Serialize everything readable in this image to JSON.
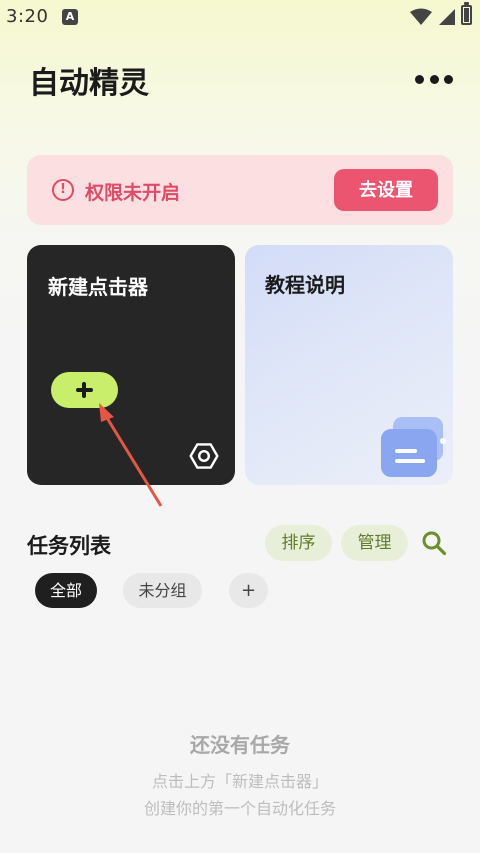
{
  "status_bar": {
    "time": "3:20",
    "notification_badge": "A",
    "icons": [
      "wifi-icon",
      "cellular-icon",
      "battery-icon"
    ]
  },
  "header": {
    "title": "自动精灵",
    "menu_icon": "more-horizontal-icon"
  },
  "permission_banner": {
    "icon": "warning-circle-icon",
    "icon_glyph": "!",
    "text": "权限未开启",
    "button_label": "去设置",
    "colors": {
      "background": "#fbdfe1",
      "accent": "#ec5570"
    }
  },
  "cards": {
    "new_clicker": {
      "title": "新建点击器",
      "add_button_glyph": "+",
      "settings_icon": "gear-icon",
      "colors": {
        "background": "#262626",
        "add_button": "#c9ee6b"
      }
    },
    "tutorial": {
      "title": "教程说明",
      "icon": "document-icon"
    }
  },
  "task_list": {
    "title": "任务列表",
    "sort_label": "排序",
    "manage_label": "管理",
    "search_icon": "search-icon",
    "filters": [
      {
        "label": "全部",
        "selected": true
      },
      {
        "label": "未分组",
        "selected": false
      },
      {
        "label": "+",
        "selected": false
      }
    ]
  },
  "empty_state": {
    "title": "还没有任务",
    "line1": "点击上方「新建点击器」",
    "line2": "创建你的第一个自动化任务"
  }
}
